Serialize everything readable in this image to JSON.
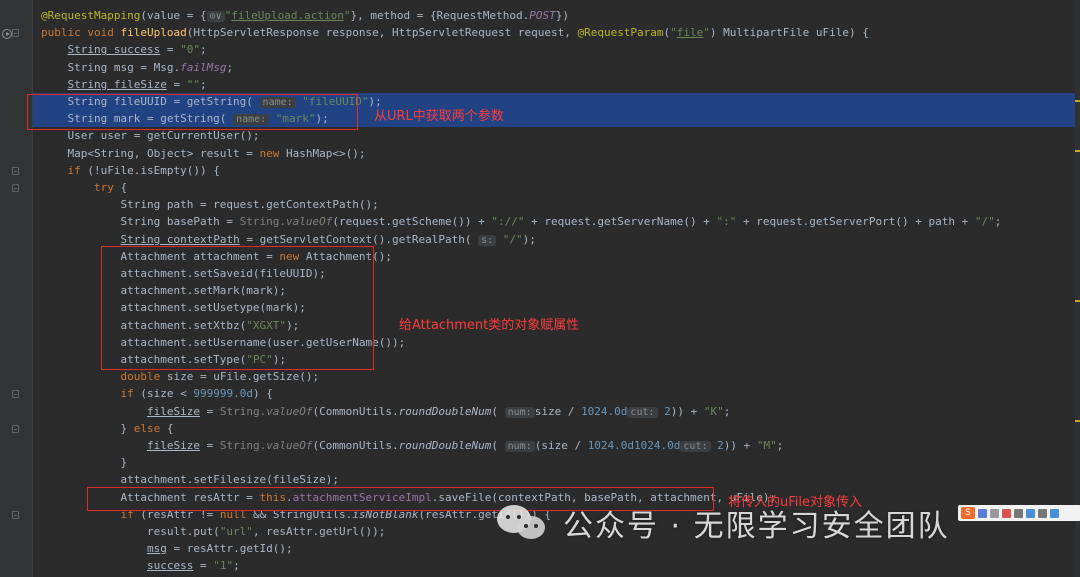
{
  "code": {
    "lines": [
      {
        "tokens": [
          [
            "ann",
            "@RequestMapping"
          ],
          [
            "",
            "(value = {"
          ],
          [
            "hint",
            "⊙∨"
          ],
          [
            "str",
            "\""
          ],
          [
            "str ul",
            "fileUpload.action"
          ],
          [
            "str",
            "\""
          ],
          [
            "",
            "}, method = {RequestMethod."
          ],
          [
            "static",
            "POST"
          ],
          [
            "",
            "})"
          ]
        ]
      },
      {
        "tokens": [
          [
            "kw",
            "public void "
          ],
          [
            "fn",
            "fileUpload"
          ],
          [
            "",
            "(HttpServletResponse response, HttpServletRequest request, "
          ],
          [
            "ann",
            "@RequestParam"
          ],
          [
            "",
            "("
          ],
          [
            "str",
            "\""
          ],
          [
            "str ul",
            "file"
          ],
          [
            "str",
            "\""
          ],
          [
            "",
            ") MultipartFile uFile) {"
          ]
        ]
      },
      {
        "tokens": [
          [
            "",
            "    "
          ],
          [
            "ul",
            "String success"
          ],
          [
            "",
            " = "
          ],
          [
            "str",
            "\"0\""
          ],
          [
            "",
            ";"
          ]
        ]
      },
      {
        "tokens": [
          [
            "",
            "    String msg = Msg."
          ],
          [
            "static",
            "failMsg"
          ],
          [
            "",
            ";"
          ]
        ]
      },
      {
        "tokens": [
          [
            "",
            "    "
          ],
          [
            "ul",
            "String fileSize"
          ],
          [
            "",
            " = "
          ],
          [
            "str",
            "\"\""
          ],
          [
            "",
            ";"
          ]
        ]
      },
      {
        "tokens": [
          [
            "",
            "    String fileUUID = getString( "
          ],
          [
            "hint",
            "name:"
          ],
          [
            "str",
            " \"fileUUID\""
          ],
          [
            "",
            ");"
          ]
        ]
      },
      {
        "tokens": [
          [
            "",
            "    String mark = getString( "
          ],
          [
            "hint",
            "name:"
          ],
          [
            "str",
            " \"mark\""
          ],
          [
            "",
            ");"
          ]
        ]
      },
      {
        "tokens": [
          [
            "",
            "    User user = getCurrentUser();"
          ]
        ]
      },
      {
        "tokens": [
          [
            "",
            "    Map<String, Object> result = "
          ],
          [
            "kw",
            "new "
          ],
          [
            "",
            "HashMap<>();"
          ]
        ]
      },
      {
        "tokens": [
          [
            "",
            "    "
          ],
          [
            "kw",
            "if "
          ],
          [
            "",
            "(!uFile.isEmpty()) {"
          ]
        ]
      },
      {
        "tokens": [
          [
            "",
            "        "
          ],
          [
            "kw",
            "try "
          ],
          [
            "",
            "{"
          ]
        ]
      },
      {
        "tokens": [
          [
            "",
            "            String path = request.getContextPath();"
          ]
        ]
      },
      {
        "tokens": [
          [
            "",
            "            String basePath = "
          ],
          [
            "dim",
            "String."
          ],
          [
            "dim smeth",
            "valueOf"
          ],
          [
            "",
            "(request.getScheme()) + "
          ],
          [
            "str",
            "\"://\""
          ],
          [
            "",
            " + request.getServerName() + "
          ],
          [
            "str",
            "\":\""
          ],
          [
            "",
            " + request.getServerPort() + path + "
          ],
          [
            "str",
            "\"/\""
          ],
          [
            "",
            ";"
          ]
        ]
      },
      {
        "tokens": [
          [
            "",
            "            "
          ],
          [
            "ul",
            "String contextPath"
          ],
          [
            "",
            " = getServletContext().getRealPath( "
          ],
          [
            "hint",
            "s:"
          ],
          [
            "str",
            " \"/\""
          ],
          [
            "",
            ");"
          ]
        ]
      },
      {
        "tokens": [
          [
            "",
            "            Attachment attachment = "
          ],
          [
            "kw",
            "new "
          ],
          [
            "",
            "Attachment();"
          ]
        ]
      },
      {
        "tokens": [
          [
            "",
            "            attachment.setSaveid(fileUUID);"
          ]
        ]
      },
      {
        "tokens": [
          [
            "",
            "            attachment.setMark(mark);"
          ]
        ]
      },
      {
        "tokens": [
          [
            "",
            "            attachment.setUsetype(mark);"
          ]
        ]
      },
      {
        "tokens": [
          [
            "",
            "            attachment.setXtbz("
          ],
          [
            "str",
            "\"XGXT\""
          ],
          [
            "",
            ");"
          ]
        ]
      },
      {
        "tokens": [
          [
            "",
            "            attachment.setUsername(user.getUserName());"
          ]
        ]
      },
      {
        "tokens": [
          [
            "",
            "            attachment.setType("
          ],
          [
            "str",
            "\"PC\""
          ],
          [
            "",
            ");"
          ]
        ]
      },
      {
        "tokens": [
          [
            "",
            "            "
          ],
          [
            "kw",
            "double "
          ],
          [
            "",
            "size = uFile.getSize();"
          ]
        ]
      },
      {
        "tokens": [
          [
            "",
            "            "
          ],
          [
            "kw",
            "if "
          ],
          [
            "",
            "(size < "
          ],
          [
            "num",
            "999999.0d"
          ],
          [
            "",
            ") {"
          ]
        ]
      },
      {
        "tokens": [
          [
            "",
            "                "
          ],
          [
            "ul",
            "fileSize"
          ],
          [
            "",
            " = "
          ],
          [
            "dim",
            "String."
          ],
          [
            "dim smeth",
            "valueOf"
          ],
          [
            "",
            "(CommonUtils."
          ],
          [
            "smeth",
            "roundDoubleNum"
          ],
          [
            "",
            "( "
          ],
          [
            "hint",
            "num:"
          ],
          [
            "",
            "size / "
          ],
          [
            "num",
            "1024.0d"
          ],
          [
            ",  "
          ],
          [
            "hint",
            "cut:"
          ],
          [
            "num",
            " 2"
          ],
          [
            "",
            ")) + "
          ],
          [
            "str",
            "\"K\""
          ],
          [
            "",
            ";"
          ]
        ]
      },
      {
        "tokens": [
          [
            "",
            "            } "
          ],
          [
            "kw",
            "else "
          ],
          [
            "",
            "{"
          ]
        ]
      },
      {
        "tokens": [
          [
            "",
            "                "
          ],
          [
            "ul",
            "fileSize"
          ],
          [
            "",
            " = "
          ],
          [
            "dim",
            "String."
          ],
          [
            "dim smeth",
            "valueOf"
          ],
          [
            "",
            "(CommonUtils."
          ],
          [
            "smeth",
            "roundDoubleNum"
          ],
          [
            "",
            "( "
          ],
          [
            "hint",
            "num:"
          ],
          [
            "",
            "(size / "
          ],
          [
            "num",
            "1024.0d"
          ],
          [
            ") / "
          ],
          [
            "num",
            "1024.0d"
          ],
          [
            ",  "
          ],
          [
            "hint",
            "cut:"
          ],
          [
            "num",
            " 2"
          ],
          [
            "",
            ")) + "
          ],
          [
            "str",
            "\"M\""
          ],
          [
            "",
            ";"
          ]
        ]
      },
      {
        "tokens": [
          [
            "",
            "            }"
          ]
        ]
      },
      {
        "tokens": [
          [
            "",
            "            attachment.setFilesize(fileSize);"
          ]
        ]
      },
      {
        "tokens": [
          [
            "",
            "            Attachment resAttr = "
          ],
          [
            "kw",
            "this"
          ],
          [
            "",
            "."
          ],
          [
            "field",
            "attachmentServiceImpl"
          ],
          [
            "",
            ".saveFile(contextPath, basePath, attachment, uFile);"
          ]
        ]
      },
      {
        "tokens": [
          [
            "",
            "            "
          ],
          [
            "kw",
            "if "
          ],
          [
            "",
            "(resAttr != "
          ],
          [
            "kw",
            "null "
          ],
          [
            "",
            "&& StringUtils."
          ],
          [
            "smeth",
            "isNotBlank"
          ],
          [
            "",
            "(resAttr.getId())) {"
          ]
        ]
      },
      {
        "tokens": [
          [
            "",
            "                result.put("
          ],
          [
            "str",
            "\"url\""
          ],
          [
            "",
            ", resAttr.getUrl());"
          ]
        ]
      },
      {
        "tokens": [
          [
            "",
            "                "
          ],
          [
            "ul",
            "msg"
          ],
          [
            "",
            " = resAttr.getId();"
          ]
        ]
      },
      {
        "tokens": [
          [
            "",
            "                "
          ],
          [
            "ul",
            "success"
          ],
          [
            "",
            " = "
          ],
          [
            "str",
            "\"1\""
          ],
          [
            "",
            ";"
          ]
        ]
      }
    ]
  },
  "annotations": [
    {
      "text": "从URL中获取两个参数"
    },
    {
      "text": "给Attachment类的对象赋属性"
    },
    {
      "text": "将传入的uFile对象传入"
    }
  ],
  "watermark": {
    "text": "公众号 · 无限学习安全团队"
  },
  "ime": {
    "logo": "S"
  },
  "colors": {
    "background": "#2b2b2b",
    "gutter": "#313335",
    "selection": "#214283",
    "keyword": "#cc7832",
    "string": "#6a8759",
    "number": "#6897bb",
    "annotation": "#bbb529",
    "field": "#9876aa",
    "default_text": "#a9b7c6",
    "note_red": "#ff3b3b"
  },
  "icons": [
    "run-gutter-icon",
    "fold-icon",
    "wechat-icon",
    "ime-logo-icon"
  ]
}
